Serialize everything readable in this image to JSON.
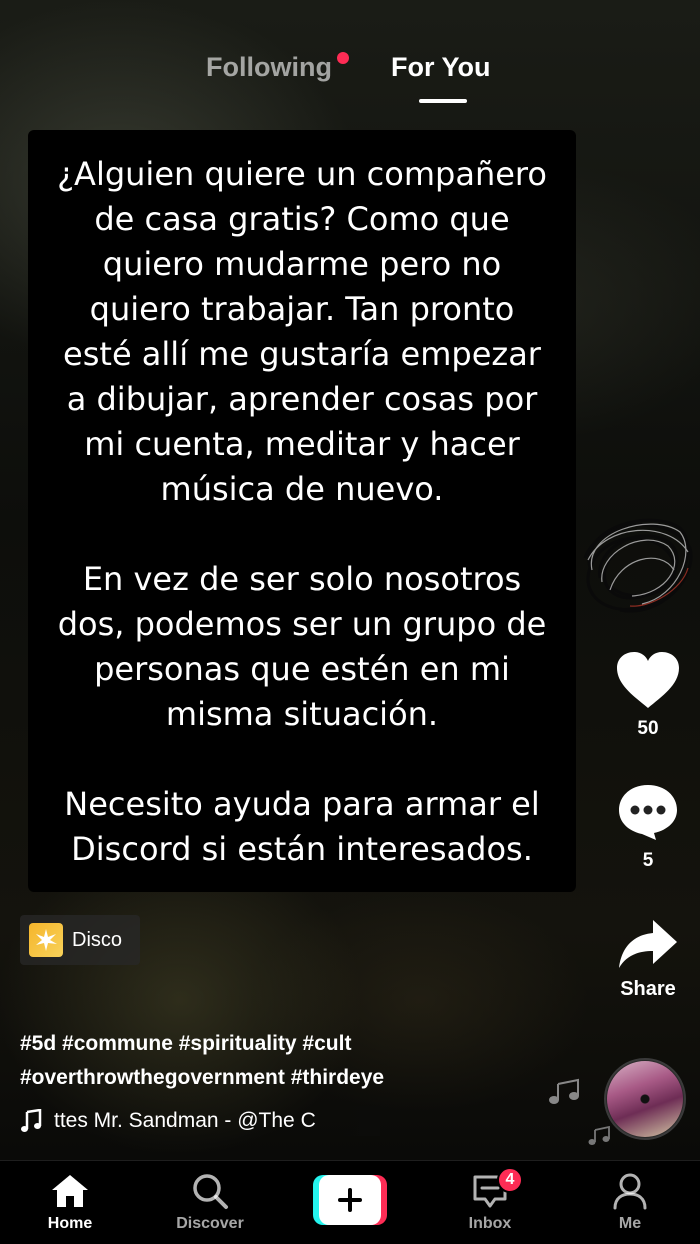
{
  "top_tabs": {
    "following": "Following",
    "for_you": "For You",
    "following_has_dot": true
  },
  "caption": {
    "paragraphs": [
      "¿Alguien quiere un compañero\nde casa gratis? Como que\nquiero mudarme pero no\nquiero trabajar. Tan pronto\nesté allí me gustaría empezar\na dibujar, aprender cosas por\nmi cuenta, meditar y hacer\nmúsica de nuevo.",
      "En vez de ser solo nosotros\ndos, podemos ser un grupo de\npersonas que estén en mi\nmisma situación.",
      "Necesito ayuda para armar el\nDiscord si están interesados."
    ]
  },
  "actions": {
    "likes": "50",
    "comments": "5",
    "share_label": "Share"
  },
  "effect": {
    "label": "Disco"
  },
  "hashtags": {
    "line1": "#5d #commune #spirituality #cult",
    "line2": "#overthrowthegovernment #thirdeye"
  },
  "music": {
    "text": "ttes     Mr. Sandman - @The C"
  },
  "bottom_nav": {
    "home": "Home",
    "discover": "Discover",
    "inbox": "Inbox",
    "inbox_badge": "4",
    "me": "Me"
  },
  "colors": {
    "accent": "#fe2c55",
    "cyan": "#25f4ee",
    "effect_icon": "#f5b52b"
  }
}
